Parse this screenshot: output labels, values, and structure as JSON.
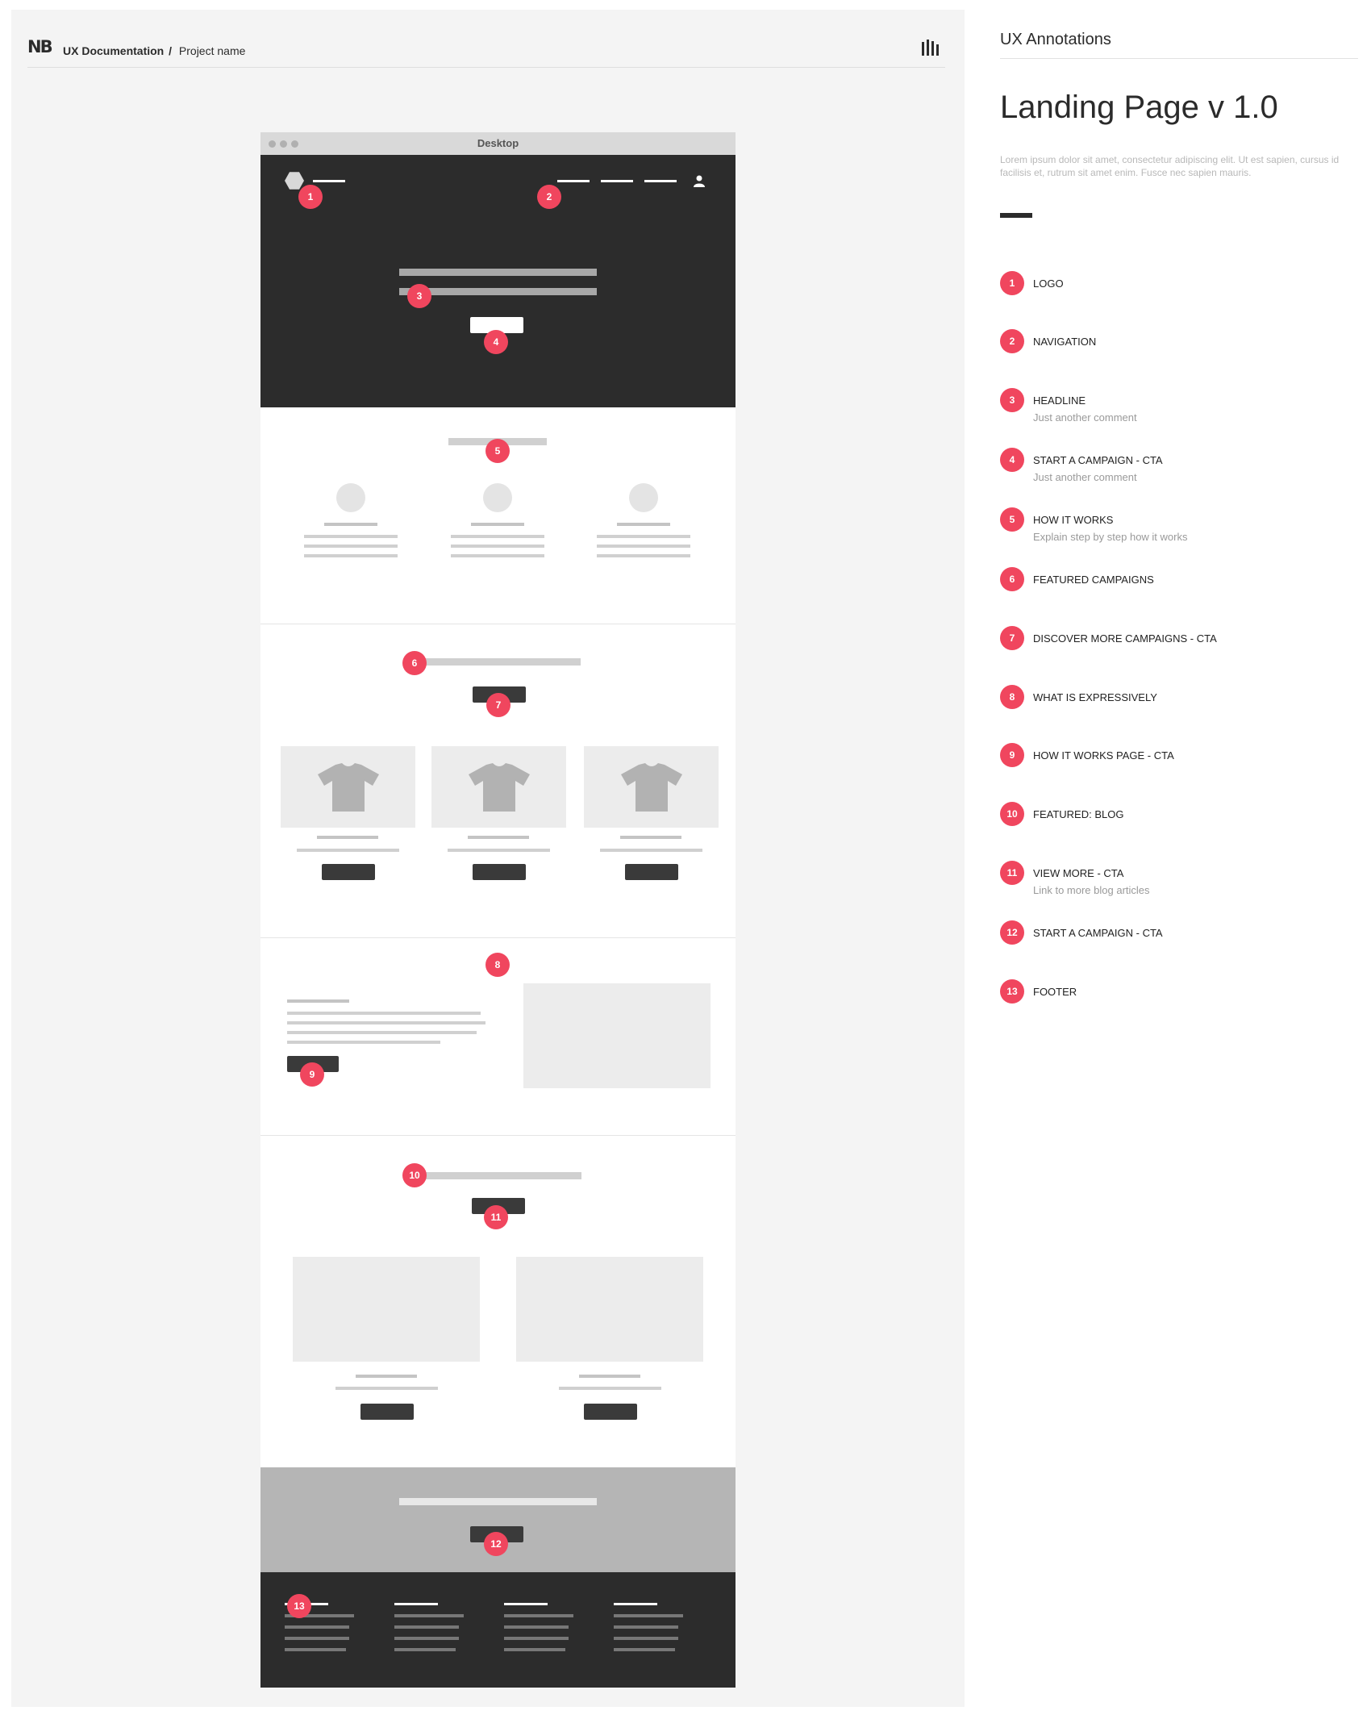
{
  "header": {
    "logo_text": "NB",
    "breadcrumb_section": "UX Documentation",
    "breadcrumb_separator": "/",
    "breadcrumb_project": "Project name",
    "right_icon": "bars-icon"
  },
  "wireframe": {
    "window_title": "Desktop"
  },
  "markers": [
    "1",
    "2",
    "3",
    "4",
    "5",
    "6",
    "7",
    "8",
    "9",
    "10",
    "11",
    "12",
    "13"
  ],
  "panel": {
    "heading": "UX Annotations",
    "title": "Landing Page v 1.0",
    "description": "Lorem ipsum dolor sit amet, consectetur adipiscing elit. Ut est sapien, cursus id facilisis et, rutrum sit amet enim. Fusce nec sapien mauris.",
    "annotations": [
      {
        "number": "1",
        "label": "LOGO",
        "comment": ""
      },
      {
        "number": "2",
        "label": "NAVIGATION",
        "comment": ""
      },
      {
        "number": "3",
        "label": "HEADLINE",
        "comment": "Just another comment"
      },
      {
        "number": "4",
        "label": "START A CAMPAIGN - CTA",
        "comment": "Just another comment"
      },
      {
        "number": "5",
        "label": "HOW IT WORKS",
        "comment": "Explain step by step how it works"
      },
      {
        "number": "6",
        "label": "FEATURED CAMPAIGNS",
        "comment": ""
      },
      {
        "number": "7",
        "label": "DISCOVER MORE CAMPAIGNS - CTA",
        "comment": ""
      },
      {
        "number": "8",
        "label": "WHAT IS EXPRESSIVELY",
        "comment": ""
      },
      {
        "number": "9",
        "label": "HOW IT WORKS PAGE - CTA",
        "comment": ""
      },
      {
        "number": "10",
        "label": "FEATURED: BLOG",
        "comment": ""
      },
      {
        "number": "11",
        "label": "VIEW MORE - CTA",
        "comment": "Link to more blog articles"
      },
      {
        "number": "12",
        "label": "START A CAMPAIGN - CTA",
        "comment": ""
      },
      {
        "number": "13",
        "label": "FOOTER",
        "comment": ""
      }
    ]
  },
  "colors": {
    "marker": "#f0465e",
    "dark": "#2c2c2c",
    "canvas": "#f4f4f4"
  }
}
